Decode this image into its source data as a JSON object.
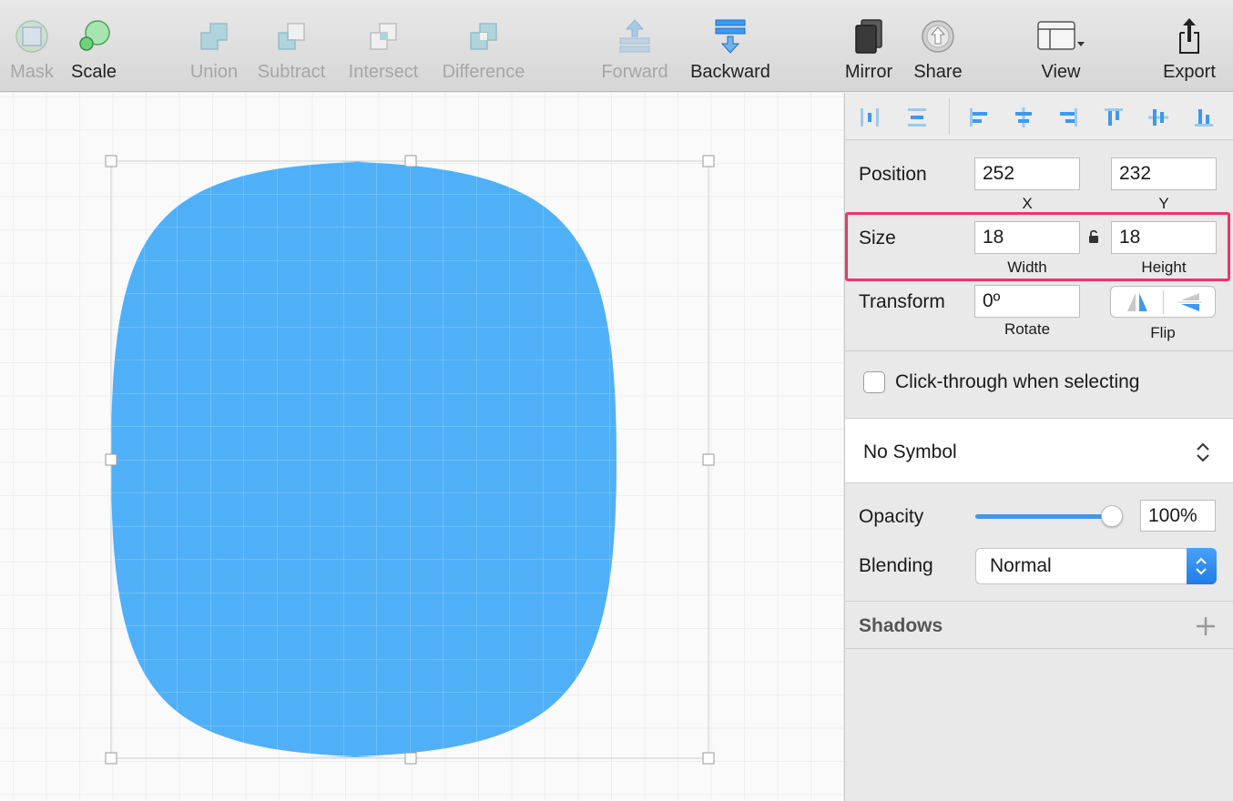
{
  "toolbar": {
    "items": [
      {
        "label": "Mask",
        "icon": "mask-icon",
        "enabled": false
      },
      {
        "label": "Scale",
        "icon": "scale-icon",
        "enabled": true
      },
      {
        "label": "Union",
        "icon": "union-icon",
        "enabled": false
      },
      {
        "label": "Subtract",
        "icon": "subtract-icon",
        "enabled": false
      },
      {
        "label": "Intersect",
        "icon": "intersect-icon",
        "enabled": false
      },
      {
        "label": "Difference",
        "icon": "difference-icon",
        "enabled": false
      },
      {
        "label": "Forward",
        "icon": "forward-icon",
        "enabled": false
      },
      {
        "label": "Backward",
        "icon": "backward-icon",
        "enabled": true
      },
      {
        "label": "Mirror",
        "icon": "mirror-icon",
        "enabled": true
      },
      {
        "label": "Share",
        "icon": "share-icon",
        "enabled": true
      },
      {
        "label": "View",
        "icon": "view-icon",
        "enabled": true
      },
      {
        "label": "Export",
        "icon": "export-icon",
        "enabled": true
      }
    ]
  },
  "canvas": {
    "shape_color": "#4fb0f8",
    "grid_line_color": "#8fcdf9"
  },
  "inspector": {
    "position": {
      "label": "Position",
      "x": "252",
      "y": "232",
      "x_label": "X",
      "y_label": "Y"
    },
    "size": {
      "label": "Size",
      "width": "18",
      "height": "18",
      "width_label": "Width",
      "height_label": "Height"
    },
    "transform": {
      "label": "Transform",
      "rotate": "0º",
      "rotate_label": "Rotate",
      "flip_label": "Flip"
    },
    "click_through": {
      "label": "Click-through when selecting",
      "checked": false
    },
    "symbol": {
      "value": "No Symbol"
    },
    "opacity": {
      "label": "Opacity",
      "value": "100%",
      "fraction": 1.0
    },
    "blending": {
      "label": "Blending",
      "value": "Normal"
    },
    "shadows": {
      "label": "Shadows"
    },
    "highlight_color": "#f0336b",
    "accent_color": "#3d98ef"
  }
}
